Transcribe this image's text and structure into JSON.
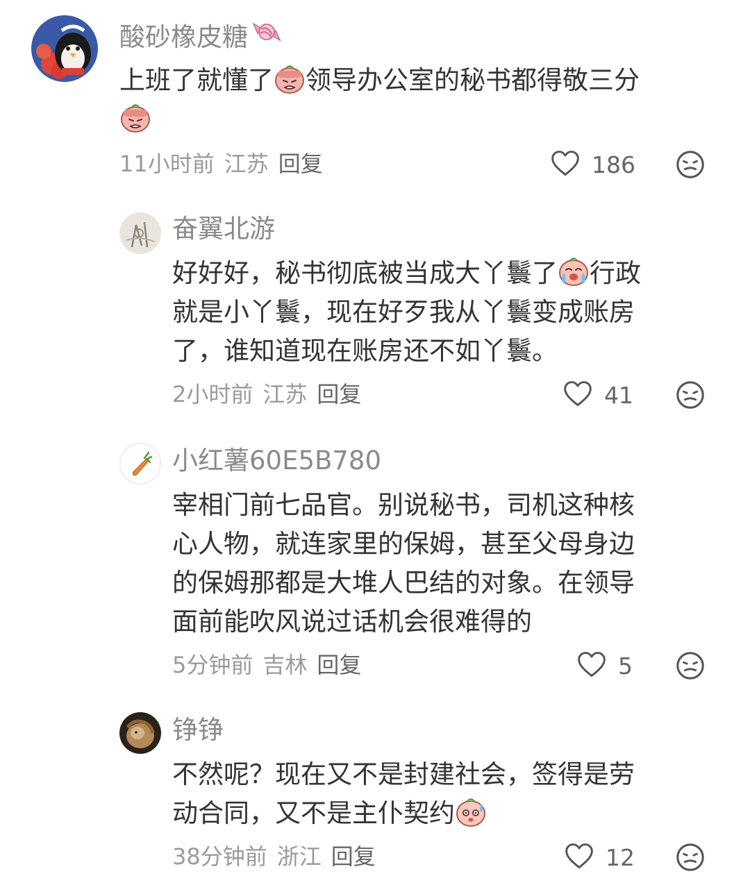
{
  "comments": [
    {
      "username": "酸砂橡皮糖",
      "username_badge": "candy-icon",
      "parts": [
        "上班了就懂了",
        "领导办公室的秘书都得敬三分",
        ""
      ],
      "emojis": [
        "facepalm-emoji",
        "facepalm-emoji"
      ],
      "time": "11小时前",
      "location": "江苏",
      "reply_label": "回复",
      "likes": "186"
    },
    {
      "username": "奋翼北游",
      "line1": "好好好，秘书彻底被当成大丫鬟了",
      "line1_tail": "行政",
      "line2": "就是小丫鬟，现在好歹我从丫鬟变成账房",
      "line3": "了，谁知道现在账房还不如丫鬟。",
      "emojis": [
        "crying-emoji"
      ],
      "time": "2小时前",
      "location": "江苏",
      "reply_label": "回复",
      "likes": "41"
    },
    {
      "username": "小红薯60E5B780",
      "lines": [
        "宰相门前七品官。别说秘书，司机这种核",
        "心人物，就连家里的保姆，甚至父母身边",
        "的保姆那都是大堆人巴结的对象。在领导",
        "面前能吹风说过话机会很难得的"
      ],
      "time": "5分钟前",
      "location": "吉林",
      "reply_label": "回复",
      "likes": "5"
    },
    {
      "username": "铮铮",
      "line1": "不然呢？现在又不是封建社会，签得是劳",
      "line2": "动合同，又不是主仆契约",
      "emojis": [
        "sweat-emoji"
      ],
      "time": "38分钟前",
      "location": "浙江",
      "reply_label": "回复",
      "likes": "12"
    }
  ],
  "icons": {
    "like": "heart-outline-icon",
    "dislike": "meh-face-icon"
  },
  "colors": {
    "text": "#333333",
    "username": "#8a8a8a",
    "meta": "#9a9a9a",
    "icon": "#555555"
  }
}
